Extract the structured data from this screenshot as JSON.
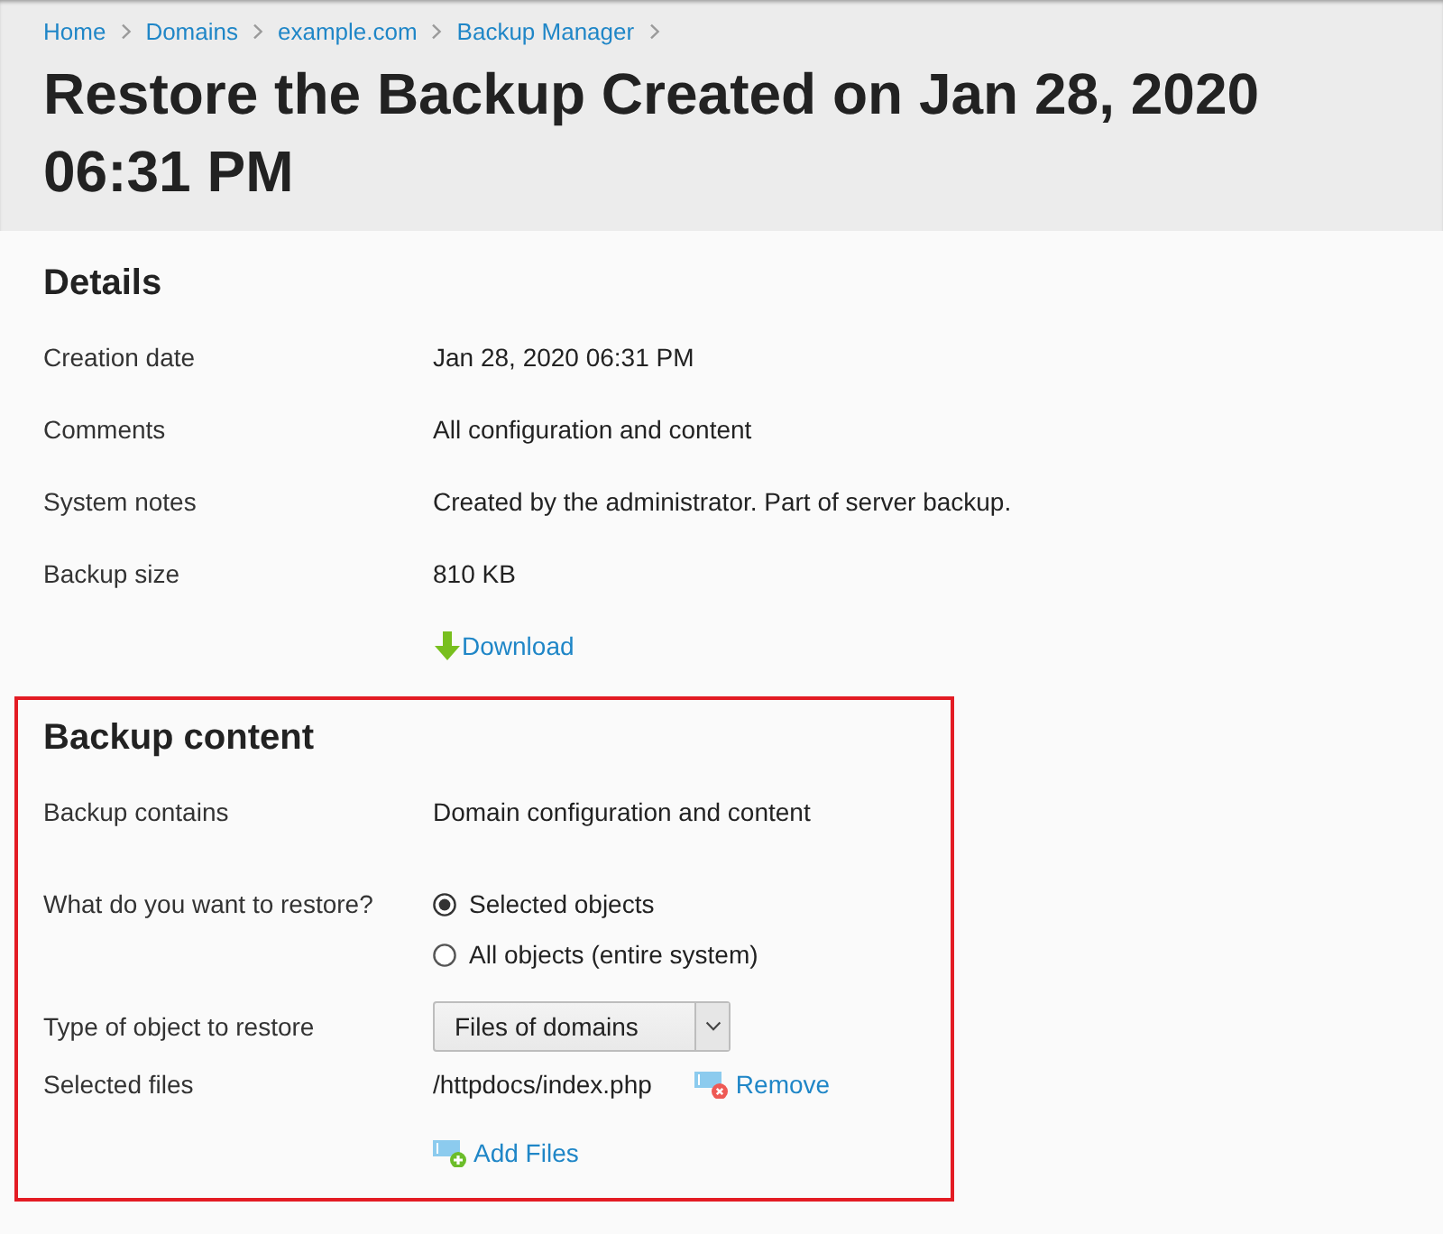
{
  "breadcrumb": [
    {
      "label": "Home"
    },
    {
      "label": "Domains"
    },
    {
      "label": "example.com"
    },
    {
      "label": "Backup Manager"
    }
  ],
  "title": "Restore the Backup Created on Jan 28, 2020 06:31 PM",
  "details": {
    "heading": "Details",
    "rows": [
      {
        "label": "Creation date",
        "value": "Jan 28, 2020 06:31 PM"
      },
      {
        "label": "Comments",
        "value": "All configuration and content"
      },
      {
        "label": "System notes",
        "value": "Created by the administrator. Part of server backup."
      },
      {
        "label": "Backup size",
        "value": "810 KB"
      }
    ],
    "download_link": "Download"
  },
  "backup_content": {
    "heading": "Backup content",
    "highlighted": true,
    "contains": {
      "label": "Backup contains",
      "value": "Domain configuration and content"
    },
    "restore_scope": {
      "label": "What do you want to restore?",
      "options": [
        {
          "label": "Selected objects",
          "selected": true
        },
        {
          "label": "All objects (entire system)",
          "selected": false
        }
      ]
    },
    "object_type": {
      "label": "Type of object to restore",
      "value": "Files of domains"
    },
    "selected_files": {
      "label": "Selected files",
      "files": [
        {
          "path": "/httpdocs/index.php",
          "action": "Remove"
        }
      ]
    },
    "add_files_link": "Add Files"
  }
}
